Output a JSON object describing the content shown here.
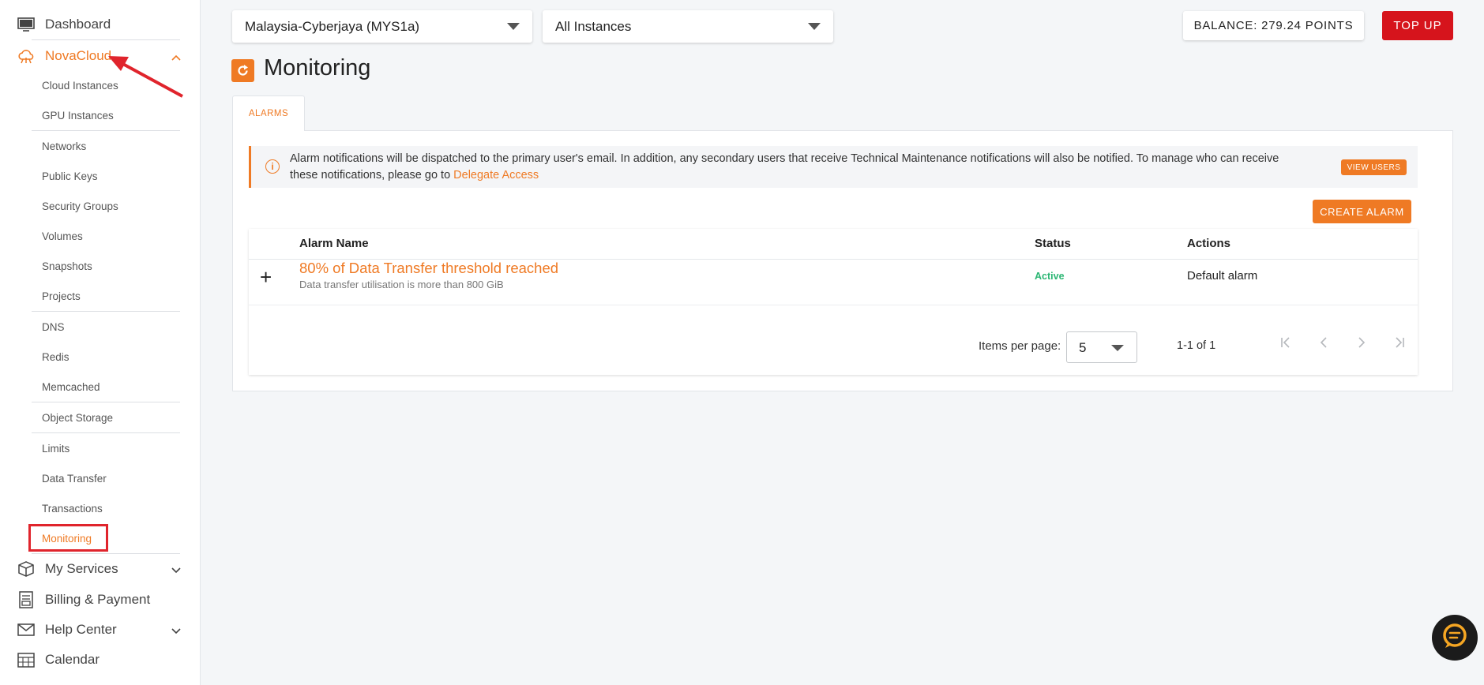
{
  "colors": {
    "accent": "#ef7a24",
    "danger": "#d6141c",
    "status_active": "#2bb673"
  },
  "sidebar": {
    "dashboard": {
      "label": "Dashboard",
      "icon": "monitor-icon"
    },
    "novacloud": {
      "label": "NovaCloud",
      "icon": "cloud-icon"
    },
    "sub_items": [
      {
        "label": "Cloud Instances"
      },
      {
        "label": "GPU Instances"
      },
      {
        "label": "Networks"
      },
      {
        "label": "Public Keys"
      },
      {
        "label": "Security Groups"
      },
      {
        "label": "Volumes"
      },
      {
        "label": "Snapshots"
      },
      {
        "label": "Projects"
      },
      {
        "label": "DNS"
      },
      {
        "label": "Redis"
      },
      {
        "label": "Memcached"
      },
      {
        "label": "Object Storage"
      },
      {
        "label": "Limits"
      },
      {
        "label": "Data Transfer"
      },
      {
        "label": "Transactions"
      },
      {
        "label": "Monitoring"
      }
    ],
    "my_services": {
      "label": "My Services",
      "icon": "box-icon"
    },
    "billing": {
      "label": "Billing & Payment",
      "icon": "receipt-icon"
    },
    "help_center": {
      "label": "Help Center",
      "icon": "mail-icon"
    },
    "calendar": {
      "label": "Calendar",
      "icon": "calendar-icon"
    }
  },
  "topbar": {
    "region": "Malaysia-Cyberjaya (MYS1a)",
    "instances": "All Instances",
    "balance": "BALANCE: 279.24 POINTS",
    "topup": "TOP UP"
  },
  "page": {
    "title": "Monitoring",
    "tab": "ALARMS",
    "alert_text": "Alarm notifications will be dispatched to the primary user's email. In addition, any secondary users that receive Technical Maintenance notifications will also be notified. To manage who can receive these notifications, please go to ",
    "alert_link": "Delegate Access",
    "view_users": "VIEW USERS",
    "create_alarm": "CREATE ALARM"
  },
  "table": {
    "headers": {
      "name": "Alarm Name",
      "status": "Status",
      "actions": "Actions"
    },
    "rows": [
      {
        "name": "80% of Data Transfer threshold reached",
        "description": "Data transfer utilisation is more than 800 GiB",
        "status": "Active",
        "action": "Default alarm"
      }
    ],
    "items_per_page_label": "Items per page:",
    "items_per_page": "5",
    "range": "1-1 of 1"
  }
}
